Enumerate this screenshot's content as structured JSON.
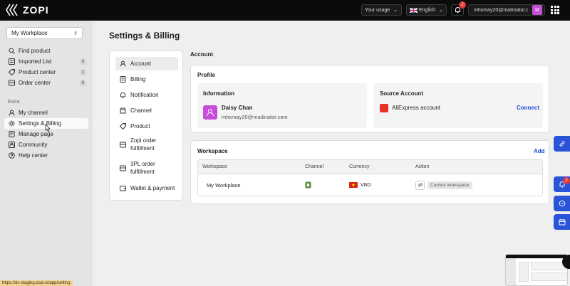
{
  "app": {
    "logo_text": "ZOPI"
  },
  "topbar": {
    "usage_label": "Your usage",
    "language_label": "English",
    "notification_count": "2",
    "email": "mhxmay20@mailinator.c...",
    "avatar_letter": "M"
  },
  "sidebar": {
    "workspace": "My Workplace",
    "items": [
      {
        "label": "Find product",
        "icon": "search-icon"
      },
      {
        "label": "Imported List",
        "icon": "list-icon",
        "count": "0"
      },
      {
        "label": "Product center",
        "icon": "tag-icon",
        "count": "1"
      },
      {
        "label": "Order center",
        "icon": "box-icon",
        "count": "0"
      }
    ],
    "extra_label": "Extra",
    "extra_items": [
      {
        "label": "My channel",
        "icon": "user-icon"
      },
      {
        "label": "Settings & Billing",
        "icon": "gear-icon"
      },
      {
        "label": "Manage page",
        "icon": "page-icon"
      },
      {
        "label": "Community",
        "icon": "community-icon"
      },
      {
        "label": "Help center",
        "icon": "help-icon"
      }
    ],
    "status_url": "https://ds-staging.zopi.io/app/setting"
  },
  "page": {
    "title": "Settings & Billing"
  },
  "settings_menu": [
    {
      "label": "Account",
      "icon": "user-icon"
    },
    {
      "label": "Billing",
      "icon": "billing-icon"
    },
    {
      "label": "Notification",
      "icon": "bell-icon"
    },
    {
      "label": "Channel",
      "icon": "channel-icon"
    },
    {
      "label": "Product",
      "icon": "tag-icon"
    },
    {
      "label": "Zopi order fulfillment",
      "icon": "box-icon"
    },
    {
      "label": "3PL order fulfillment",
      "icon": "box-icon"
    },
    {
      "label": "Wallet & payment",
      "icon": "wallet-icon"
    }
  ],
  "account": {
    "section_title": "Account",
    "profile_title": "Profile",
    "information_title": "Information",
    "user_name": "Daisy Chan",
    "user_email": "mhxmay20@mailinator.com",
    "source_title": "Source Account",
    "source_name": "AliExpress account",
    "connect_label": "Connect"
  },
  "workspace": {
    "title": "Workspace",
    "add_label": "Add",
    "columns": [
      "Workspace",
      "Channel",
      "Currency",
      "Action"
    ],
    "rows": [
      {
        "name": "My Workplace",
        "currency": "VND",
        "status": "Current workspace"
      }
    ]
  },
  "floating": {
    "badge": "2"
  }
}
